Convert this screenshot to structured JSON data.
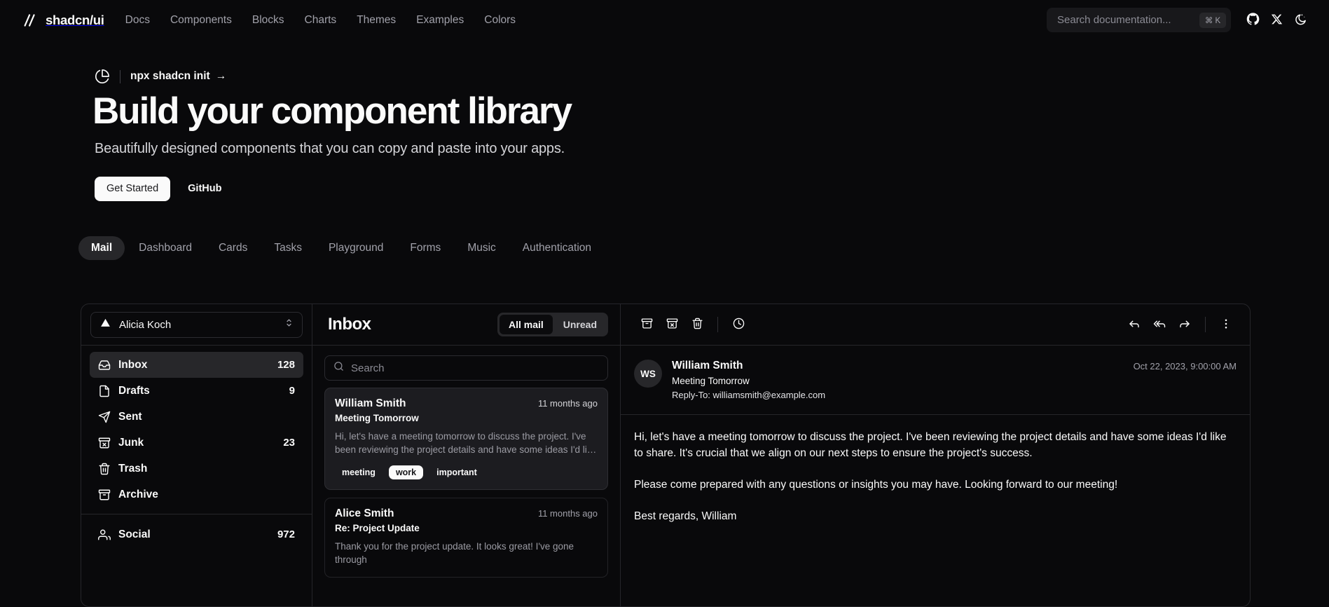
{
  "header": {
    "brand": "shadcn/ui",
    "nav": [
      {
        "label": "Docs"
      },
      {
        "label": "Components"
      },
      {
        "label": "Blocks"
      },
      {
        "label": "Charts"
      },
      {
        "label": "Themes"
      },
      {
        "label": "Examples"
      },
      {
        "label": "Colors"
      }
    ],
    "search": {
      "placeholder": "Search documentation...",
      "shortcut": "⌘ K"
    },
    "icons": {
      "github": "github-icon",
      "x": "x-twitter-icon",
      "theme": "theme-toggle-moon-icon"
    }
  },
  "hero": {
    "announcement": "npx shadcn init",
    "announcement_arrow": "→",
    "title": "Build your component library",
    "subtitle": "Beautifully designed components that you can copy and paste into your apps.",
    "primary_button": "Get Started",
    "secondary_button": "GitHub"
  },
  "example_tabs": [
    {
      "label": "Mail",
      "active": true
    },
    {
      "label": "Dashboard",
      "active": false
    },
    {
      "label": "Cards",
      "active": false
    },
    {
      "label": "Tasks",
      "active": false
    },
    {
      "label": "Playground",
      "active": false
    },
    {
      "label": "Forms",
      "active": false
    },
    {
      "label": "Music",
      "active": false
    },
    {
      "label": "Authentication",
      "active": false
    }
  ],
  "mail": {
    "account": {
      "name": "Alicia Koch"
    },
    "folders": [
      {
        "label": "Inbox",
        "count": "128",
        "icon": "inbox-icon",
        "active": true
      },
      {
        "label": "Drafts",
        "count": "9",
        "icon": "file-icon",
        "active": false
      },
      {
        "label": "Sent",
        "count": "",
        "icon": "send-icon",
        "active": false
      },
      {
        "label": "Junk",
        "count": "23",
        "icon": "archive-x-icon",
        "active": false
      },
      {
        "label": "Trash",
        "count": "",
        "icon": "trash-icon",
        "active": false
      },
      {
        "label": "Archive",
        "count": "",
        "icon": "archive-icon",
        "active": false
      }
    ],
    "folders2": [
      {
        "label": "Social",
        "count": "972",
        "icon": "users-icon",
        "active": false
      }
    ],
    "list": {
      "title": "Inbox",
      "filters": [
        {
          "label": "All mail",
          "active": true
        },
        {
          "label": "Unread",
          "active": false
        }
      ],
      "search_placeholder": "Search",
      "items": [
        {
          "name": "William Smith",
          "time": "11 months ago",
          "subject": "Meeting Tomorrow",
          "excerpt": "Hi, let's have a meeting tomorrow to discuss the project. I've been reviewing the project details and have some ideas I'd like to shar…",
          "badges": [
            {
              "label": "meeting",
              "style": "ghost"
            },
            {
              "label": "work",
              "style": "solid"
            },
            {
              "label": "important",
              "style": "ghost"
            }
          ],
          "selected": true
        },
        {
          "name": "Alice Smith",
          "time": "11 months ago",
          "subject": "Re: Project Update",
          "excerpt": "Thank you for the project update. It looks great! I've gone through",
          "badges": [],
          "selected": false
        }
      ]
    },
    "reading": {
      "toolbar_left": [
        "archive-icon",
        "archive-x-icon",
        "trash-icon",
        "snooze-clock-icon"
      ],
      "toolbar_right": [
        "reply-icon",
        "reply-all-icon",
        "forward-icon",
        "more-vertical-icon"
      ],
      "avatar_initials": "WS",
      "sender": "William Smith",
      "subject": "Meeting Tomorrow",
      "reply_to": "Reply-To: williamsmith@example.com",
      "date": "Oct 22, 2023, 9:00:00 AM",
      "body": "Hi, let's have a meeting tomorrow to discuss the project. I've been reviewing the project details and have some ideas I'd like to share. It's crucial that we align on our next steps to ensure the project's success.\n\nPlease come prepared with any questions or insights you may have. Looking forward to our meeting!\n\nBest regards, William"
    }
  },
  "colors": {
    "background": "#09090b",
    "foreground": "#fafafa",
    "muted": "#a1a1aa",
    "accent": "#27272a",
    "border": "#26262a"
  }
}
